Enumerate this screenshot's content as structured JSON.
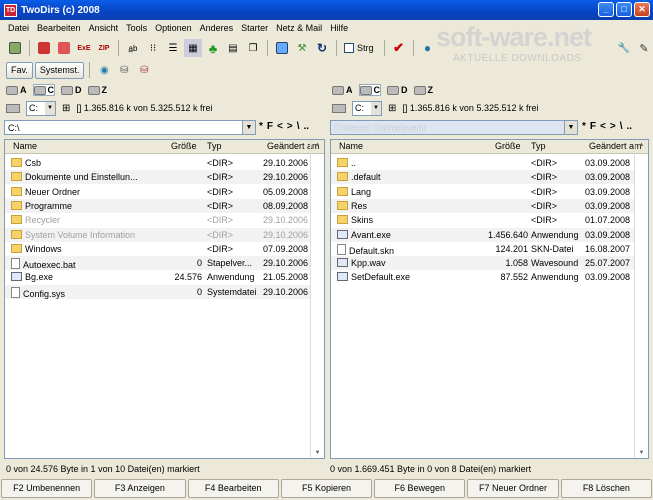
{
  "window": {
    "title": "TwoDirs (c) 2008",
    "app_icon": "TD"
  },
  "menu": [
    "Datei",
    "Bearbeiten",
    "Ansicht",
    "Tools",
    "Optionen",
    "Anderes",
    "Starter",
    "Netz & Mail",
    "Hilfe"
  ],
  "toolbar": {
    "strg_label": "Strg",
    "fav_label": "Fav.",
    "systemst_label": "Systemst."
  },
  "watermark": {
    "brand": "soft-ware.net",
    "tagline": "AKTUELLE DOWNLOADS"
  },
  "columns": {
    "name": "Name",
    "size": "Größe",
    "type": "Typ",
    "changed": "Geändert am"
  },
  "left": {
    "drives": [
      "A",
      "C",
      "D",
      "Z"
    ],
    "drive_combo": "C:",
    "free_space": "[] 1.365.816 k von 5.325.512 k frei",
    "path": "C:\\",
    "nav": [
      "*",
      "F",
      "<",
      ">",
      "\\",
      ".."
    ],
    "rows": [
      {
        "name": "Csb",
        "size": "",
        "type": "<DIR>",
        "date": "29.10.2006",
        "kind": "folder"
      },
      {
        "name": "Dokumente und Einstellun...",
        "size": "",
        "type": "<DIR>",
        "date": "29.10.2006",
        "kind": "folder"
      },
      {
        "name": "Neuer Ordner",
        "size": "",
        "type": "<DIR>",
        "date": "05.09.2008",
        "kind": "folder"
      },
      {
        "name": "Programme",
        "size": "",
        "type": "<DIR>",
        "date": "08.09.2008",
        "kind": "folder"
      },
      {
        "name": "Recycler",
        "size": "",
        "type": "<DIR>",
        "date": "29.10.2006",
        "kind": "folder",
        "dim": true
      },
      {
        "name": "System Volume Information",
        "size": "",
        "type": "<DIR>",
        "date": "29.10.2006",
        "kind": "folder",
        "dim": true
      },
      {
        "name": "Windows",
        "size": "",
        "type": "<DIR>",
        "date": "07.09.2008",
        "kind": "folder"
      },
      {
        "name": "Autoexec.bat",
        "size": "0",
        "type": "Stapelver...",
        "date": "29.10.2006",
        "kind": "file"
      },
      {
        "name": "Bg.exe",
        "size": "24.576",
        "type": "Anwendung",
        "date": "21.05.2008",
        "kind": "exe"
      },
      {
        "name": "Config.sys",
        "size": "0",
        "type": "Systemdatei",
        "date": "29.10.2006",
        "kind": "file"
      }
    ],
    "status": "0 von 24.576 Byte in 1 von 10 Datei(en) markiert"
  },
  "right": {
    "drives": [
      "A",
      "C",
      "D",
      "Z"
    ],
    "drive_combo": "C:",
    "free_space": "[] 1.365.816 k von 5.325.512 k frei",
    "path": "C:\\Neuer Ordner\\avant",
    "nav": [
      "*",
      "F",
      "<",
      ">",
      "\\",
      ".."
    ],
    "rows": [
      {
        "name": "..",
        "size": "",
        "type": "<DIR>",
        "date": "03.09.2008",
        "kind": "folder"
      },
      {
        "name": ".default",
        "size": "",
        "type": "<DIR>",
        "date": "03.09.2008",
        "kind": "folder"
      },
      {
        "name": "Lang",
        "size": "",
        "type": "<DIR>",
        "date": "03.09.2008",
        "kind": "folder"
      },
      {
        "name": "Res",
        "size": "",
        "type": "<DIR>",
        "date": "03.09.2008",
        "kind": "folder"
      },
      {
        "name": "Skins",
        "size": "",
        "type": "<DIR>",
        "date": "01.07.2008",
        "kind": "folder"
      },
      {
        "name": "Avant.exe",
        "size": "1.456.640",
        "type": "Anwendung",
        "date": "03.09.2008",
        "kind": "exe"
      },
      {
        "name": "Default.skn",
        "size": "124.201",
        "type": "SKN-Datei",
        "date": "16.08.2007",
        "kind": "file"
      },
      {
        "name": "Kpp.wav",
        "size": "1.058",
        "type": "Wavesound",
        "date": "25.07.2007",
        "kind": "exe"
      },
      {
        "name": "SetDefault.exe",
        "size": "87.552",
        "type": "Anwendung",
        "date": "03.09.2008",
        "kind": "exe"
      }
    ],
    "status": "0 von 1.669.451 Byte in 0 von 8 Datei(en) markiert"
  },
  "fkeys": [
    "F2 Umbenennen",
    "F3 Anzeigen",
    "F4 Bearbeiten",
    "F5 Kopieren",
    "F6 Bewegen",
    "F7 Neuer Ordner",
    "F8 Löschen"
  ]
}
